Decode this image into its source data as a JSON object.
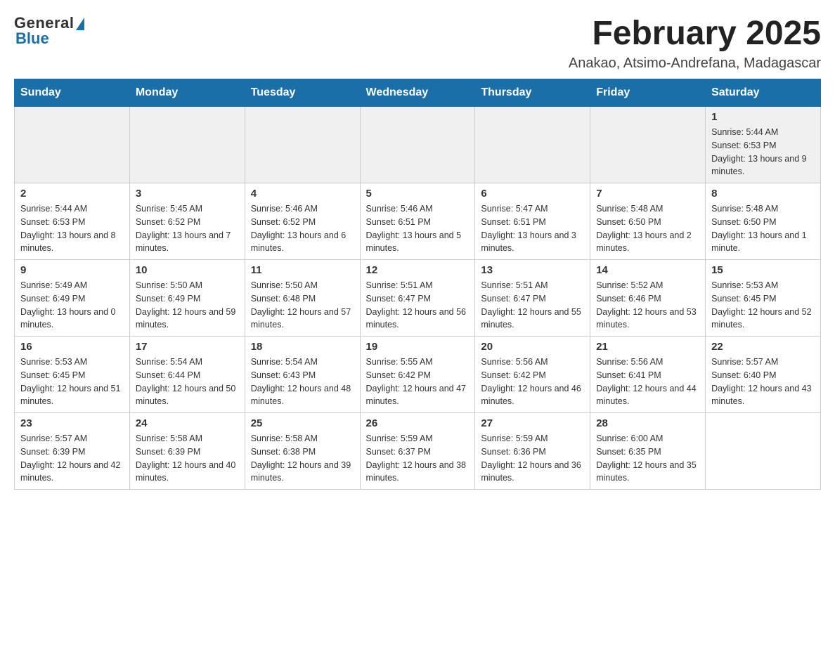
{
  "logo": {
    "general": "General",
    "blue": "Blue"
  },
  "title": "February 2025",
  "location": "Anakao, Atsimo-Andrefana, Madagascar",
  "days_of_week": [
    "Sunday",
    "Monday",
    "Tuesday",
    "Wednesday",
    "Thursday",
    "Friday",
    "Saturday"
  ],
  "weeks": [
    [
      {
        "day": "",
        "info": ""
      },
      {
        "day": "",
        "info": ""
      },
      {
        "day": "",
        "info": ""
      },
      {
        "day": "",
        "info": ""
      },
      {
        "day": "",
        "info": ""
      },
      {
        "day": "",
        "info": ""
      },
      {
        "day": "1",
        "info": "Sunrise: 5:44 AM\nSunset: 6:53 PM\nDaylight: 13 hours and 9 minutes."
      }
    ],
    [
      {
        "day": "2",
        "info": "Sunrise: 5:44 AM\nSunset: 6:53 PM\nDaylight: 13 hours and 8 minutes."
      },
      {
        "day": "3",
        "info": "Sunrise: 5:45 AM\nSunset: 6:52 PM\nDaylight: 13 hours and 7 minutes."
      },
      {
        "day": "4",
        "info": "Sunrise: 5:46 AM\nSunset: 6:52 PM\nDaylight: 13 hours and 6 minutes."
      },
      {
        "day": "5",
        "info": "Sunrise: 5:46 AM\nSunset: 6:51 PM\nDaylight: 13 hours and 5 minutes."
      },
      {
        "day": "6",
        "info": "Sunrise: 5:47 AM\nSunset: 6:51 PM\nDaylight: 13 hours and 3 minutes."
      },
      {
        "day": "7",
        "info": "Sunrise: 5:48 AM\nSunset: 6:50 PM\nDaylight: 13 hours and 2 minutes."
      },
      {
        "day": "8",
        "info": "Sunrise: 5:48 AM\nSunset: 6:50 PM\nDaylight: 13 hours and 1 minute."
      }
    ],
    [
      {
        "day": "9",
        "info": "Sunrise: 5:49 AM\nSunset: 6:49 PM\nDaylight: 13 hours and 0 minutes."
      },
      {
        "day": "10",
        "info": "Sunrise: 5:50 AM\nSunset: 6:49 PM\nDaylight: 12 hours and 59 minutes."
      },
      {
        "day": "11",
        "info": "Sunrise: 5:50 AM\nSunset: 6:48 PM\nDaylight: 12 hours and 57 minutes."
      },
      {
        "day": "12",
        "info": "Sunrise: 5:51 AM\nSunset: 6:47 PM\nDaylight: 12 hours and 56 minutes."
      },
      {
        "day": "13",
        "info": "Sunrise: 5:51 AM\nSunset: 6:47 PM\nDaylight: 12 hours and 55 minutes."
      },
      {
        "day": "14",
        "info": "Sunrise: 5:52 AM\nSunset: 6:46 PM\nDaylight: 12 hours and 53 minutes."
      },
      {
        "day": "15",
        "info": "Sunrise: 5:53 AM\nSunset: 6:45 PM\nDaylight: 12 hours and 52 minutes."
      }
    ],
    [
      {
        "day": "16",
        "info": "Sunrise: 5:53 AM\nSunset: 6:45 PM\nDaylight: 12 hours and 51 minutes."
      },
      {
        "day": "17",
        "info": "Sunrise: 5:54 AM\nSunset: 6:44 PM\nDaylight: 12 hours and 50 minutes."
      },
      {
        "day": "18",
        "info": "Sunrise: 5:54 AM\nSunset: 6:43 PM\nDaylight: 12 hours and 48 minutes."
      },
      {
        "day": "19",
        "info": "Sunrise: 5:55 AM\nSunset: 6:42 PM\nDaylight: 12 hours and 47 minutes."
      },
      {
        "day": "20",
        "info": "Sunrise: 5:56 AM\nSunset: 6:42 PM\nDaylight: 12 hours and 46 minutes."
      },
      {
        "day": "21",
        "info": "Sunrise: 5:56 AM\nSunset: 6:41 PM\nDaylight: 12 hours and 44 minutes."
      },
      {
        "day": "22",
        "info": "Sunrise: 5:57 AM\nSunset: 6:40 PM\nDaylight: 12 hours and 43 minutes."
      }
    ],
    [
      {
        "day": "23",
        "info": "Sunrise: 5:57 AM\nSunset: 6:39 PM\nDaylight: 12 hours and 42 minutes."
      },
      {
        "day": "24",
        "info": "Sunrise: 5:58 AM\nSunset: 6:39 PM\nDaylight: 12 hours and 40 minutes."
      },
      {
        "day": "25",
        "info": "Sunrise: 5:58 AM\nSunset: 6:38 PM\nDaylight: 12 hours and 39 minutes."
      },
      {
        "day": "26",
        "info": "Sunrise: 5:59 AM\nSunset: 6:37 PM\nDaylight: 12 hours and 38 minutes."
      },
      {
        "day": "27",
        "info": "Sunrise: 5:59 AM\nSunset: 6:36 PM\nDaylight: 12 hours and 36 minutes."
      },
      {
        "day": "28",
        "info": "Sunrise: 6:00 AM\nSunset: 6:35 PM\nDaylight: 12 hours and 35 minutes."
      },
      {
        "day": "",
        "info": ""
      }
    ]
  ]
}
